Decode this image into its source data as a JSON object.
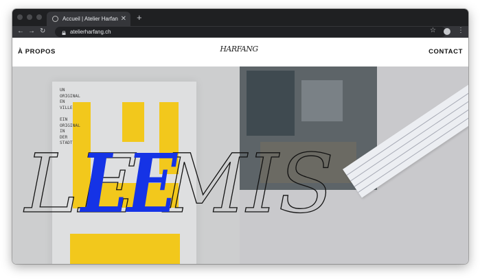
{
  "browser": {
    "tab_title": "Accueil | Atelier Harfang | rens",
    "url": "atelierharfang.ch",
    "new_tab_symbol": "+",
    "tab_close_symbol": "✕",
    "icons": [
      "back-icon",
      "forward-icon",
      "reload-icon",
      "lock-icon",
      "star-icon",
      "profile-icon",
      "menu-icon"
    ]
  },
  "site": {
    "nav_left": "À PROPOS",
    "logo": "HARFANG",
    "nav_right": "CONTACT"
  },
  "hero": {
    "headline": "LE MIS",
    "poster_text": "UN\nORIGINAL\nEN\nVILLE\n\nEIN\nORIGINAL\nIN\nDER\nSTADT"
  },
  "colors": {
    "accent_blue": "#1533e6",
    "poster_yellow": "#f2c81c",
    "chrome_dark": "#1f2022",
    "chrome_toolbar": "#35363a"
  }
}
